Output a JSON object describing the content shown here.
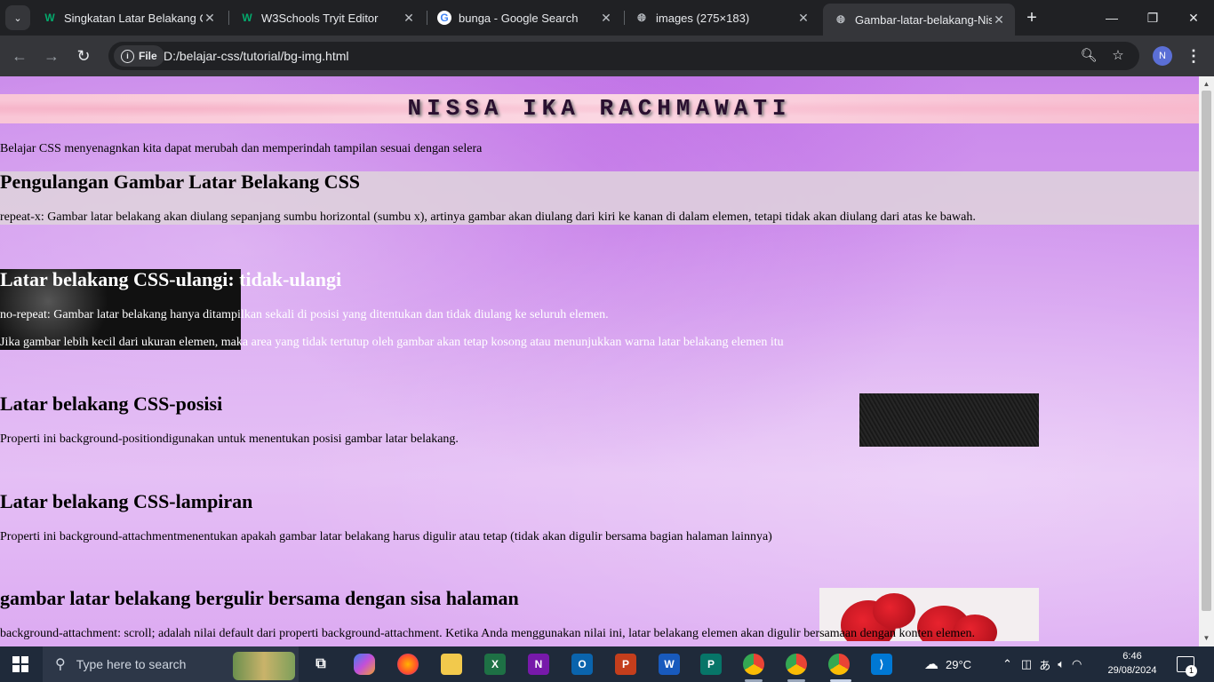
{
  "browser": {
    "tabs": [
      {
        "title": "Singkatan Latar Belakang CSS",
        "favicon": "W",
        "favicon_color": "#04aa6d"
      },
      {
        "title": "W3Schools Tryit Editor",
        "favicon": "W",
        "favicon_color": "#04aa6d"
      },
      {
        "title": "bunga - Google Search",
        "favicon": "G",
        "favicon_color": "#4285f4"
      },
      {
        "title": "images (275×183)",
        "favicon": "globe-icon",
        "favicon_color": "#bdc1c6"
      },
      {
        "title": "Gambar-latar-belakang-Nissa",
        "favicon": "globe-icon",
        "favicon_color": "#bdc1c6",
        "active": true
      }
    ],
    "address": {
      "chip_label": "File",
      "url": "D:/belajar-css/tutorial/bg-img.html"
    },
    "profile_initial": "N"
  },
  "page": {
    "banner_title": "NISSA IKA RACHMAWATI",
    "intro": "Belajar CSS menyenagnkan kita dapat merubah dan memperindah tampilan sesuai dengan selera",
    "sections": [
      {
        "heading": "Pengulangan Gambar Latar Belakang CSS",
        "paragraphs": [
          "repeat-x: Gambar latar belakang akan diulang sepanjang sumbu horizontal (sumbu x), artinya gambar akan diulang dari kiri ke kanan di dalam elemen, tetapi tidak akan diulang dari atas ke bawah."
        ]
      },
      {
        "heading": "Latar belakang CSS-ulangi: tidak-ulangi",
        "paragraphs": [
          "no-repeat: Gambar latar belakang hanya ditampilkan sekali di posisi yang ditentukan dan tidak diulang ke seluruh elemen.",
          "Jika gambar lebih kecil dari ukuran elemen, maka area yang tidak tertutup oleh gambar akan tetap kosong atau menunjukkan warna latar belakang elemen itu"
        ]
      },
      {
        "heading": "Latar belakang CSS-posisi",
        "paragraphs": [
          "Properti ini background-positiondigunakan untuk menentukan posisi gambar latar belakang."
        ]
      },
      {
        "heading": "Latar belakang CSS-lampiran",
        "paragraphs": [
          "Properti ini background-attachmentmenentukan apakah gambar latar belakang harus digulir atau tetap (tidak akan digulir bersama bagian halaman lainnya)"
        ]
      },
      {
        "heading": "gambar latar belakang bergulir bersama dengan sisa halaman",
        "paragraphs": [
          "background-attachment: scroll; adalah nilai default dari properti background-attachment. Ketika Anda menggunakan nilai ini, latar belakang elemen akan digulir bersamaan dengan konten elemen."
        ]
      }
    ]
  },
  "taskbar": {
    "search_placeholder": "Type here to search",
    "apps": [
      "task-view-icon",
      "copilot-icon",
      "firefox-icon",
      "file-explorer-icon",
      "excel-icon",
      "onenote-icon",
      "outlook-icon",
      "powerpoint-icon",
      "word-icon",
      "publisher-icon",
      "chrome-icon",
      "chrome-icon",
      "chrome-icon",
      "vscode-icon"
    ],
    "weather": "29°C",
    "time": "6:46",
    "date": "29/08/2024",
    "notification_count": "1"
  }
}
